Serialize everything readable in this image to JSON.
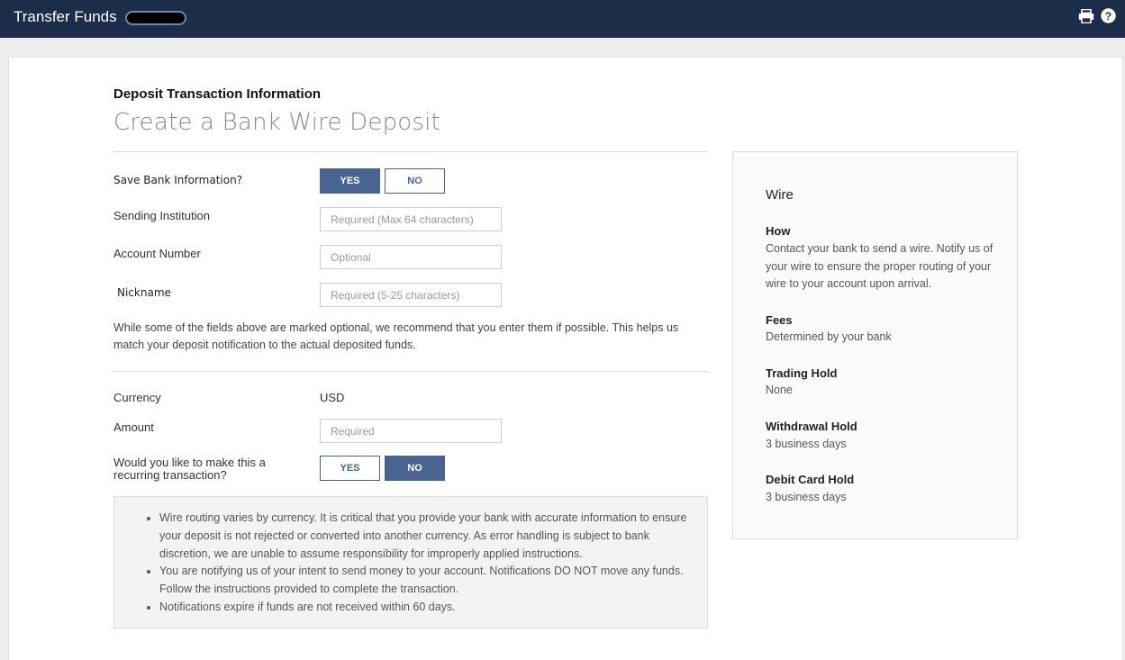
{
  "header": {
    "title": "Transfer Funds",
    "print_icon": "print-icon",
    "help_icon": "help-icon"
  },
  "form": {
    "section_label": "Deposit Transaction Information",
    "page_title": "Create a Bank Wire Deposit",
    "save_bank": {
      "label": "Save Bank Information?",
      "yes": "YES",
      "no": "NO",
      "selected": "YES"
    },
    "sending_institution": {
      "label": "Sending Institution",
      "placeholder": "Required (Max 64 characters)",
      "value": ""
    },
    "account_number": {
      "label": "Account Number",
      "placeholder": "Optional",
      "value": ""
    },
    "nickname": {
      "label": "Nickname",
      "placeholder": "Required (5-25 characters)",
      "value": ""
    },
    "note": "While some of the fields above are marked optional, we recommend that you enter them if possible. This helps us match your deposit notification to the actual deposited funds.",
    "currency": {
      "label": "Currency",
      "value": "USD"
    },
    "amount": {
      "label": "Amount",
      "placeholder": "Required",
      "value": ""
    },
    "recurring": {
      "label_line1": "Would you like to make this a",
      "label_line2": "recurring transaction?",
      "yes": "YES",
      "no": "NO",
      "selected": "NO"
    },
    "bullets": [
      "Wire routing varies by currency. It is critical that you provide your bank with accurate information to ensure your deposit is not rejected or converted into another currency. As error handling is subject to bank discretion, we are unable to assume responsibility for improperly applied instructions.",
      "You are notifying us of your intent to send money to your account. Notifications DO NOT move any funds. Follow the instructions provided to complete the transaction.",
      "Notifications expire if funds are not received within 60 days."
    ]
  },
  "sidebar": {
    "title": "Wire",
    "how_heading": "How",
    "how_text": "Contact your bank to send a wire. Notify us of your wire to ensure the proper routing of your wire to your account upon arrival.",
    "fees_heading": "Fees",
    "fees_text": "Determined by your bank",
    "trading_hold_heading": "Trading Hold",
    "trading_hold_text": "None",
    "withdrawal_hold_heading": "Withdrawal Hold",
    "withdrawal_hold_text": "3 business days",
    "debit_card_hold_heading": "Debit Card Hold",
    "debit_card_hold_text": "3 business days"
  },
  "colors": {
    "header_bg": "#1c2d4a",
    "accent": "#4a6491"
  }
}
